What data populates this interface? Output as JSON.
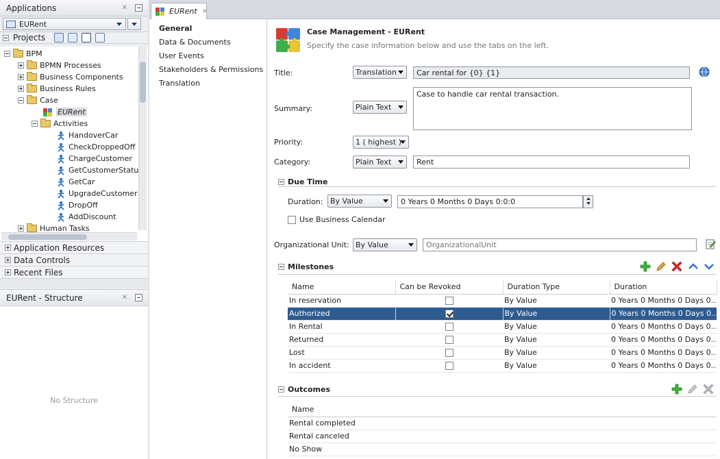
{
  "applications_panel": {
    "title": "Applications",
    "app_combo": "EURent",
    "projects_label": "Projects",
    "tree": [
      {
        "label": "BPM",
        "kind": "folder",
        "depth": 0,
        "expanded": true
      },
      {
        "label": "BPMN Processes",
        "kind": "folder",
        "depth": 1,
        "expanded": false
      },
      {
        "label": "Business Components",
        "kind": "folder",
        "depth": 1,
        "expanded": false
      },
      {
        "label": "Business Rules",
        "kind": "folder",
        "depth": 1,
        "expanded": false
      },
      {
        "label": "Case",
        "kind": "folder",
        "depth": 1,
        "expanded": true
      },
      {
        "label": "EURent",
        "kind": "case",
        "depth": 2,
        "selected": true
      },
      {
        "label": "Activities",
        "kind": "folder",
        "depth": 2,
        "expanded": true
      },
      {
        "label": "HandoverCar",
        "kind": "activity",
        "depth": 3
      },
      {
        "label": "CheckDroppedOff",
        "kind": "activity",
        "depth": 3
      },
      {
        "label": "ChargeCustomer",
        "kind": "activity",
        "depth": 3
      },
      {
        "label": "GetCustomerStatu",
        "kind": "activity",
        "depth": 3
      },
      {
        "label": "GetCar",
        "kind": "activity",
        "depth": 3
      },
      {
        "label": "UpgradeCustomer",
        "kind": "activity",
        "depth": 3
      },
      {
        "label": "DropOff",
        "kind": "activity",
        "depth": 3
      },
      {
        "label": "AddDiscount",
        "kind": "activity",
        "depth": 3
      },
      {
        "label": "Human Tasks",
        "kind": "folder",
        "depth": 1,
        "expanded": false
      }
    ],
    "accordion": [
      "Application Resources",
      "Data Controls",
      "Recent Files"
    ]
  },
  "structure_panel": {
    "title": "EURent - Structure",
    "empty_text": "No Structure"
  },
  "editor": {
    "tab_label": "EURent",
    "nav": [
      "General",
      "Data & Documents",
      "User Events",
      "Stakeholders & Permissions",
      "Translation"
    ],
    "header": {
      "title": "Case Management - EURent",
      "subtitle": "Specify the case information below and use the tabs on the left."
    },
    "form": {
      "title_label": "Title:",
      "title_mode": "Translation",
      "title_value": "Car rental for {0} {1}",
      "summary_label": "Summary:",
      "summary_mode": "Plain Text",
      "summary_value": "Case to handle car rental transaction.",
      "priority_label": "Priority:",
      "priority_value": "1 ( highest )",
      "category_label": "Category:",
      "category_mode": "Plain Text",
      "category_value": "Rent",
      "due_time_label": "Due Time",
      "duration_label": "Duration:",
      "duration_mode": "By Value",
      "duration_value": "0 Years 0 Months 0 Days 0:0:0",
      "business_calendar_label": "Use Business Calendar",
      "org_unit_label": "Organizational Unit:",
      "org_unit_mode": "By Value",
      "org_unit_placeholder": "OrganizationalUnit"
    },
    "milestones": {
      "label": "Milestones",
      "columns": [
        "Name",
        "Can be Revoked",
        "Duration Type",
        "Duration"
      ],
      "rows": [
        {
          "name": "In reservation",
          "revoked": false,
          "type": "By Value",
          "duration": "0 Years 0 Months 0 Days 0..."
        },
        {
          "name": "Authorized",
          "revoked": true,
          "type": "By Value",
          "duration": "0 Years 0 Months 0 Days 0...",
          "selected": true
        },
        {
          "name": "In Rental",
          "revoked": false,
          "type": "By Value",
          "duration": "0 Years 0 Months 0 Days 0..."
        },
        {
          "name": "Returned",
          "revoked": false,
          "type": "By Value",
          "duration": "0 Years 0 Months 0 Days 0..."
        },
        {
          "name": "Lost",
          "revoked": false,
          "type": "By Value",
          "duration": "0 Years 0 Months 0 Days 0..."
        },
        {
          "name": "In accident",
          "revoked": false,
          "type": "By Value",
          "duration": "0 Years 0 Months 0 Days 0..."
        }
      ]
    },
    "outcomes": {
      "label": "Outcomes",
      "columns": [
        "Name"
      ],
      "rows": [
        "Rental completed",
        "Rental canceled",
        "No Show"
      ]
    }
  }
}
